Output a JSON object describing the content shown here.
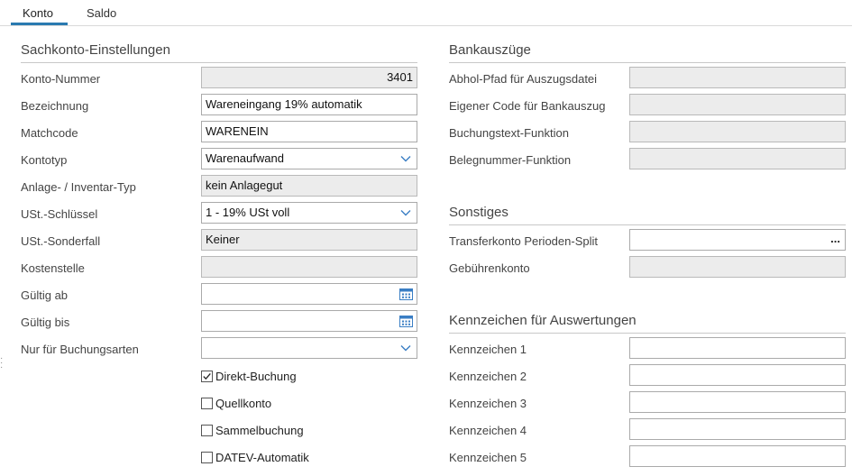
{
  "tabs": [
    {
      "label": "Konto",
      "active": true
    },
    {
      "label": "Saldo",
      "active": false
    }
  ],
  "colors": {
    "accent": "#2a7ab0",
    "calendar_icon": "#3a7ec4"
  },
  "left": {
    "section_title": "Sachkonto-Einstellungen",
    "konto_nummer": {
      "label": "Konto-Nummer",
      "value": "3401"
    },
    "bezeichnung": {
      "label": "Bezeichnung",
      "value": "Wareneingang 19% automatik"
    },
    "matchcode": {
      "label": "Matchcode",
      "value": "WARENEIN"
    },
    "kontotyp": {
      "label": "Kontotyp",
      "value": "Warenaufwand"
    },
    "anlage_typ": {
      "label": "Anlage- / Inventar-Typ",
      "value": "kein Anlagegut"
    },
    "ust_schluessel": {
      "label": "USt.-Schlüssel",
      "value": "1 - 19% USt voll"
    },
    "ust_sonderfall": {
      "label": "USt.-Sonderfall",
      "value": "Keiner"
    },
    "kostenstelle": {
      "label": "Kostenstelle",
      "value": ""
    },
    "gueltig_ab": {
      "label": "Gültig ab",
      "value": ""
    },
    "gueltig_bis": {
      "label": "Gültig bis",
      "value": ""
    },
    "buchungsarten": {
      "label": "Nur für Buchungsarten",
      "value": ""
    },
    "checkboxes": [
      {
        "label": "Direkt-Buchung",
        "checked": true
      },
      {
        "label": "Quellkonto",
        "checked": false
      },
      {
        "label": "Sammelbuchung",
        "checked": false
      },
      {
        "label": "DATEV-Automatik",
        "checked": false
      }
    ]
  },
  "right": {
    "bank_title": "Bankauszüge",
    "bank_fields": [
      {
        "label": "Abhol-Pfad für Auszugsdatei",
        "value": ""
      },
      {
        "label": "Eigener Code für Bankauszug",
        "value": ""
      },
      {
        "label": "Buchungstext-Funktion",
        "value": ""
      },
      {
        "label": "Belegnummer-Funktion",
        "value": ""
      }
    ],
    "sonstiges_title": "Sonstiges",
    "transferkonto": {
      "label": "Transferkonto Perioden-Split",
      "value": "",
      "button": "..."
    },
    "gebuehrenkonto": {
      "label": "Gebührenkonto",
      "value": ""
    },
    "kennzeichen_title": "Kennzeichen für Auswertungen",
    "kennzeichen": [
      {
        "label": "Kennzeichen 1",
        "value": ""
      },
      {
        "label": "Kennzeichen 2",
        "value": ""
      },
      {
        "label": "Kennzeichen 3",
        "value": ""
      },
      {
        "label": "Kennzeichen 4",
        "value": ""
      },
      {
        "label": "Kennzeichen 5",
        "value": ""
      }
    ]
  }
}
